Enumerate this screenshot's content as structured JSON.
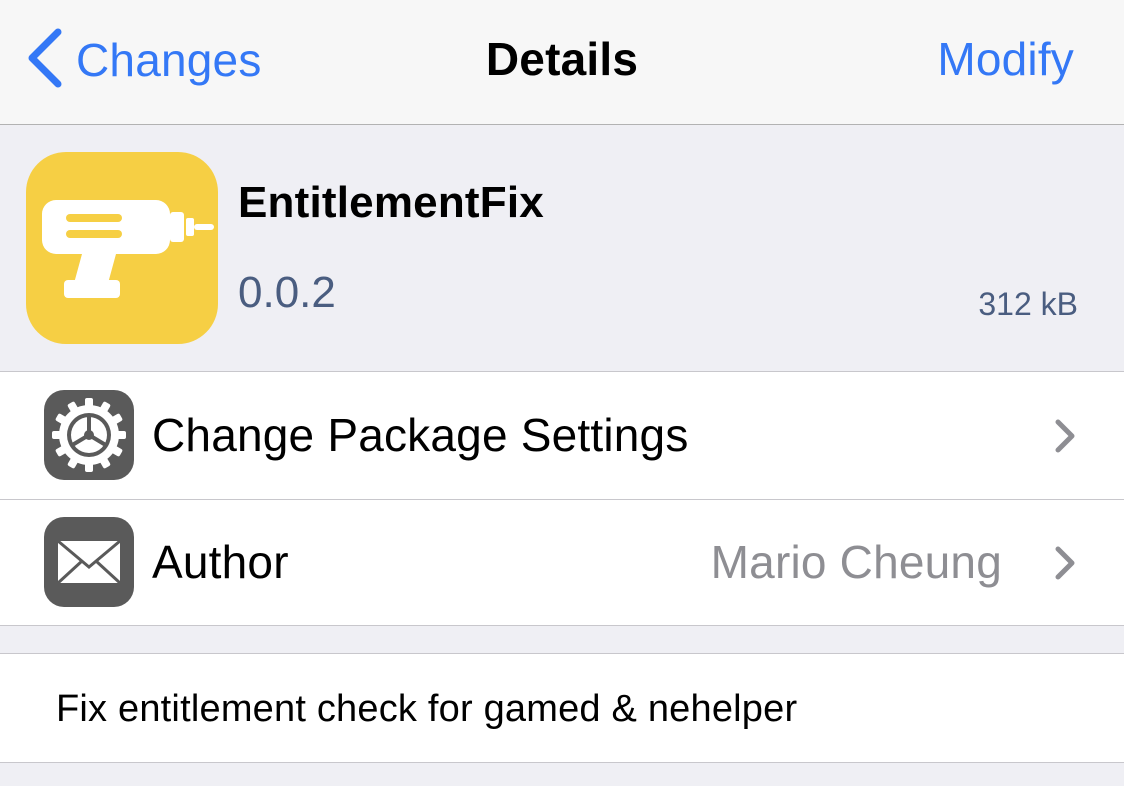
{
  "navbar": {
    "back_label": "Changes",
    "title": "Details",
    "right_label": "Modify"
  },
  "package": {
    "name": "EntitlementFix",
    "version": "0.0.2",
    "size": "312 kB",
    "icon": "drill-icon",
    "icon_color": "#f6cf44"
  },
  "rows": [
    {
      "label": "Change Package Settings",
      "value": "",
      "icon": "gear-icon"
    },
    {
      "label": "Author",
      "value": "Mario Cheung",
      "icon": "envelope-icon"
    }
  ],
  "description": "Fix entitlement check for gamed & nehelper",
  "colors": {
    "accent": "#3478f6",
    "background": "#efeff4",
    "secondary_text": "#8e8e93",
    "version_text": "#4a5d80"
  }
}
